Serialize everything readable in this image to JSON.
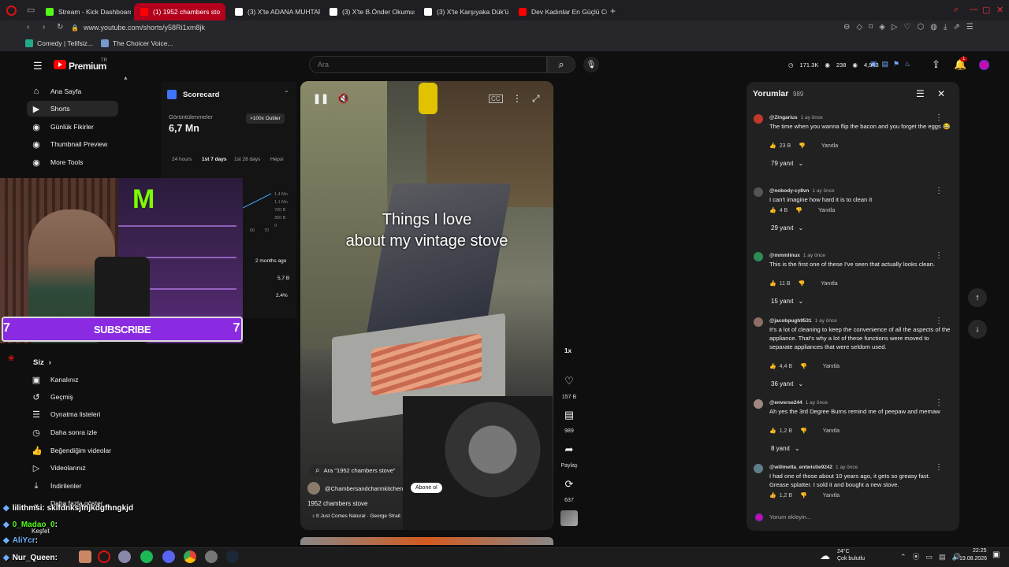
{
  "browser": {
    "tabs": [
      {
        "label": "Stream - Kick Dashboard",
        "color": "#53fc18"
      },
      {
        "label": "(1) 1952 chambers sto",
        "color": "#ff0000",
        "active": true
      },
      {
        "label": "(3) X'te ADANA MUHTARI",
        "color": "#ffffff"
      },
      {
        "label": "(3) X'te B.Önder Okumuş",
        "color": "#ffffff"
      },
      {
        "label": "(3) X'te Karşıyaka Dük'ü",
        "color": "#ffffff"
      },
      {
        "label": "Dev Kadınlar En Güçlü Cücı",
        "color": "#ff0000"
      }
    ],
    "new_tab": "+",
    "url": "www.youtube.com/shorts/y58Ri1xm8jk",
    "bookmarks": [
      "Comedy | Telifsiz...",
      "The Choicer Voice..."
    ]
  },
  "yt": {
    "logo_text": "Premium",
    "logo_sup": "TR",
    "search_placeholder": "Ara",
    "header_stats": [
      "171.3K",
      "238",
      "4,943"
    ],
    "notif_count": "1"
  },
  "sidebar": {
    "items": [
      {
        "label": "Ana Sayfa",
        "icon": "home-icon",
        "glyph": "⌂"
      },
      {
        "label": "Shorts",
        "icon": "shorts-icon",
        "glyph": "▶",
        "selected": true
      },
      {
        "label": "Günlük Fikirler",
        "icon": "ext-icon",
        "glyph": "◉"
      },
      {
        "label": "Thumbnail Preview",
        "icon": "ext-icon",
        "glyph": "◉"
      },
      {
        "label": "More Tools",
        "icon": "ext-icon",
        "glyph": "◉"
      }
    ],
    "you_header": "Siz",
    "you_items": [
      {
        "label": "Kanalınız",
        "icon": "channel-icon",
        "glyph": "▣"
      },
      {
        "label": "Geçmiş",
        "icon": "history-icon",
        "glyph": "↺"
      },
      {
        "label": "Oynatma listeleri",
        "icon": "playlist-icon",
        "glyph": "☰"
      },
      {
        "label": "Daha sonra izle",
        "icon": "clock-icon",
        "glyph": "◷"
      },
      {
        "label": "Beğendiğim videolar",
        "icon": "like-icon",
        "glyph": "👍"
      },
      {
        "label": "Videolarınız",
        "icon": "video-icon",
        "glyph": "▷"
      },
      {
        "label": "İndirilenler",
        "icon": "download-icon",
        "glyph": "⤓"
      },
      {
        "label": "Daha fazla göster",
        "icon": "more-icon",
        "glyph": "⌄"
      }
    ]
  },
  "scorecard": {
    "title": "Scorecard",
    "views_label": "Görüntülenmeler",
    "views_value": "6,7 Mn",
    "outlier_badge": ">100x Outlier",
    "ranges": [
      "24 hours",
      "1st 7 days",
      "1st 28 days",
      "Hepsi"
    ],
    "chart_ticks": [
      "1,4 Mn",
      "1,1 Mn",
      "700 B",
      "350 B",
      "0"
    ],
    "chart_x": [
      "60",
      "70"
    ],
    "age": "2 months ago",
    "stat1": "5,7 B",
    "stat2": "2.4%"
  },
  "webcam": {
    "subscribe": "SUBSCRIBE",
    "num_left": "7",
    "num_right": "7"
  },
  "short": {
    "overlay_line1": "Things I love",
    "overlay_line2": "about my vintage stove",
    "search_chip": "Ara \"1952 chambers stove\"",
    "channel": "@Chambersandcharmkitchen",
    "subscribe": "Abone ol",
    "title": "1952 chambers stove",
    "music": "♪ It Just Comes Natural · George Strait",
    "speed": "1x",
    "likes": "157 B",
    "comments": "989",
    "share": "Paylaş",
    "remix": "637"
  },
  "comments_panel": {
    "title": "Yorumlar",
    "count": "989",
    "reply_label": "Yanıtla",
    "add_placeholder": "Yorum ekleyin...",
    "items": [
      {
        "user": "@Zingarius",
        "time": "1 ay önce",
        "text": "The time when you wanna flip the bacon and you forget the eggs 😂",
        "likes": "23 B",
        "replies": "79 yanıt",
        "color": "#c0392b"
      },
      {
        "user": "@nobody-cy8vn",
        "time": "1 ay önce",
        "text": "I can't imagine how hard it is to clean it",
        "likes": "4 B",
        "replies": "29 yanıt",
        "color": "#555555"
      },
      {
        "user": "@mmmlinux",
        "time": "1 ay önce",
        "text": "This is the first one of these I've seen that actually looks clean.",
        "likes": "11 B",
        "replies": "15 yanıt",
        "color": "#2e8b57"
      },
      {
        "user": "@jacobpugh9531",
        "time": "1 ay önce",
        "text": "It's a lot of cleaning to keep the convenience of all the aspects of the appliance. That's why a lot of these functions were moved to separate appliances that were seldom used.",
        "likes": "4,4 B",
        "replies": "36 yanıt",
        "color": "#8d6e63"
      },
      {
        "user": "@enverse244",
        "time": "1 ay önce",
        "text": "Ah yes the 3rd Degree Burns remind me of peepaw and memaw",
        "likes": "1,2 B",
        "replies": "8 yanıt",
        "color": "#a1887f"
      },
      {
        "user": "@willmetta_entwistle9242",
        "time": "1 ay önce",
        "text": "I had one of those about 10 years ago, it gets so greasy fast. Grease splatter. I sold it and bought a new stove.",
        "likes": "1,2 B",
        "replies": "",
        "color": "#607d8b"
      }
    ]
  },
  "chat": [
    {
      "user": "lilithmsi",
      "msg": ": skifdnksjfnjkdgfhngkjd",
      "color": "#ffffff"
    },
    {
      "user": "0_Madao_0",
      "msg": ":",
      "color": "#53fc18"
    },
    {
      "user": "AliYcr",
      "msg": ":",
      "color": "#6fb1ff"
    },
    {
      "user": "Nur_Queen",
      "msg": ":",
      "color": "#ffffff"
    }
  ],
  "explore_label": "Keşfet",
  "taskbar": {
    "weather_temp": "24°C",
    "weather_desc": "Çok bulutlu",
    "time": "22:25",
    "date": "19.08.2026"
  }
}
